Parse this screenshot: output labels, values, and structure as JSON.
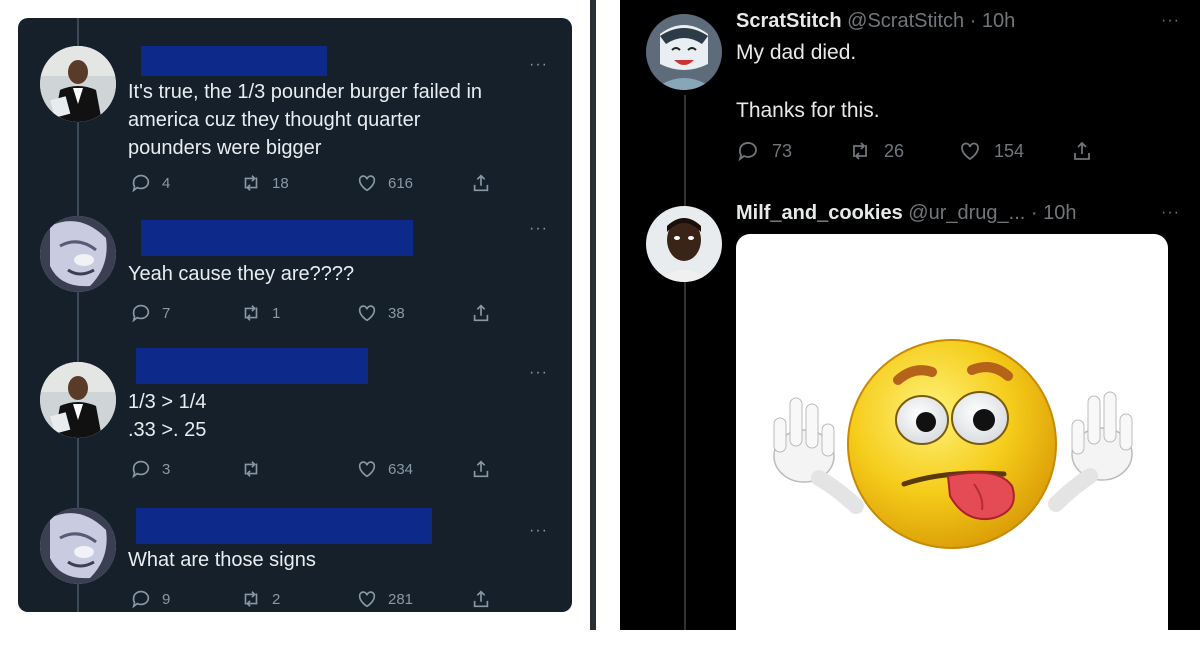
{
  "left": {
    "tweets": [
      {
        "text": "It's true, the 1/3 pounder burger failed in\namerica cuz they thought quarter\npounders were bigger",
        "replies": "4",
        "retweets": "18",
        "likes": "616"
      },
      {
        "text": "Yeah cause they are????",
        "replies": "7",
        "retweets": "1",
        "likes": "38"
      },
      {
        "text": "1/3 > 1/4\n.33 >. 25",
        "replies": "3",
        "retweets": "",
        "likes": "634"
      },
      {
        "text": "What are those signs",
        "replies": "9",
        "retweets": "2",
        "likes": "281"
      }
    ],
    "more_label": "···"
  },
  "right": {
    "tweet1": {
      "name": "ScratStitch",
      "handle": "@ScratStitch · 10h",
      "line1": "My dad died.",
      "line2": "Thanks for this.",
      "replies": "73",
      "retweets": "26",
      "likes": "154"
    },
    "tweet2": {
      "name": "Milf_and_cookies",
      "handle": "@ur_drug_... · 10h"
    },
    "more_label": "···"
  },
  "colors": {
    "left_bg": "#15202b",
    "right_bg": "#000000",
    "redaction": "#0d2a8a",
    "muted": "#8899a6",
    "emoji_yellow": "#f5cc1a"
  },
  "icons": [
    "reply-icon",
    "retweet-icon",
    "like-icon",
    "share-icon",
    "more-icon"
  ]
}
